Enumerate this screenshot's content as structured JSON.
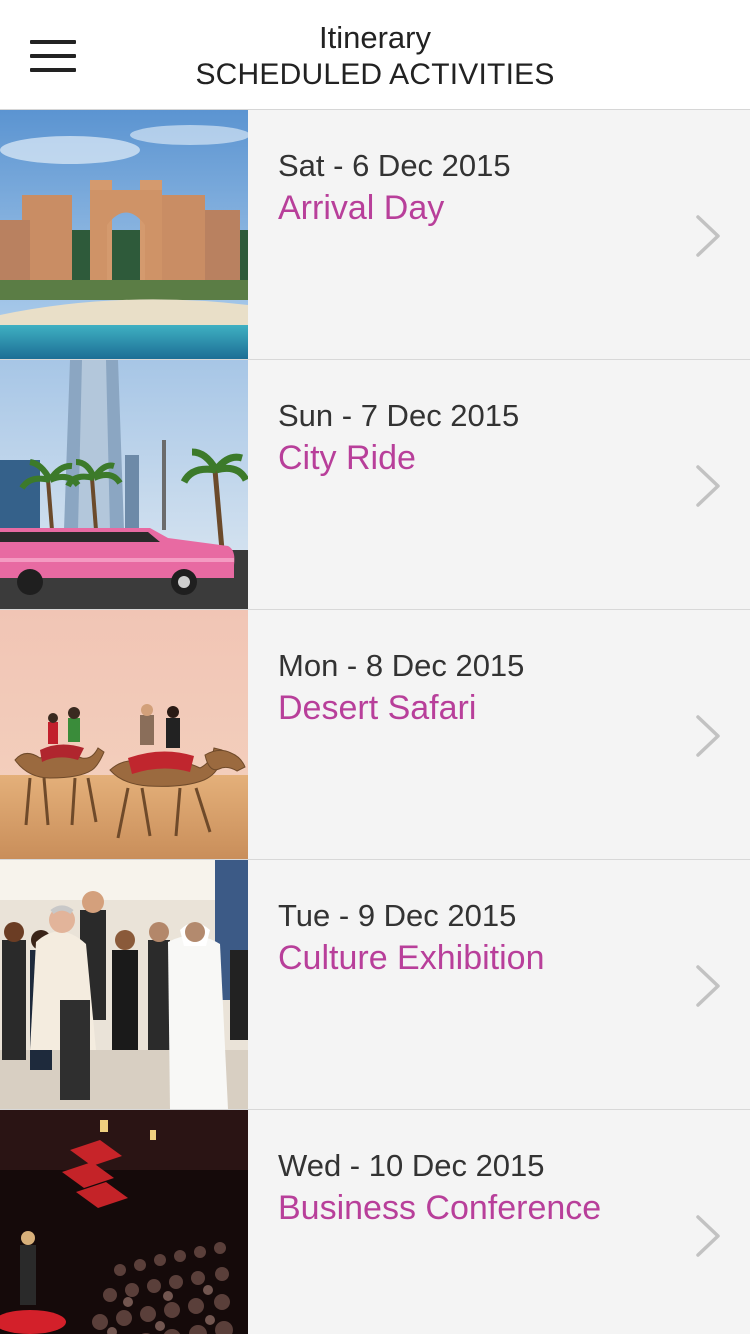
{
  "header": {
    "title": "Itinerary",
    "subtitle": "SCHEDULED ACTIVITIES",
    "menu_icon": "hamburger-menu-icon"
  },
  "colors": {
    "accent": "#b83f9a",
    "background": "#f4f4f4",
    "chevron": "#c2c2c2"
  },
  "itinerary": [
    {
      "date": "Sat - 6 Dec 2015",
      "activity": "Arrival Day",
      "image": "atlantis-hotel-photo"
    },
    {
      "date": "Sun - 7 Dec 2015",
      "activity": "City Ride",
      "image": "pink-limousine-photo"
    },
    {
      "date": "Mon - 8 Dec 2015",
      "activity": "Desert Safari",
      "image": "camel-ride-photo"
    },
    {
      "date": "Tue - 9 Dec 2015",
      "activity": "Culture Exhibition",
      "image": "exhibition-crowd-photo"
    },
    {
      "date": "Wed - 10 Dec 2015",
      "activity": "Business Conference",
      "image": "conference-stage-photo"
    }
  ]
}
